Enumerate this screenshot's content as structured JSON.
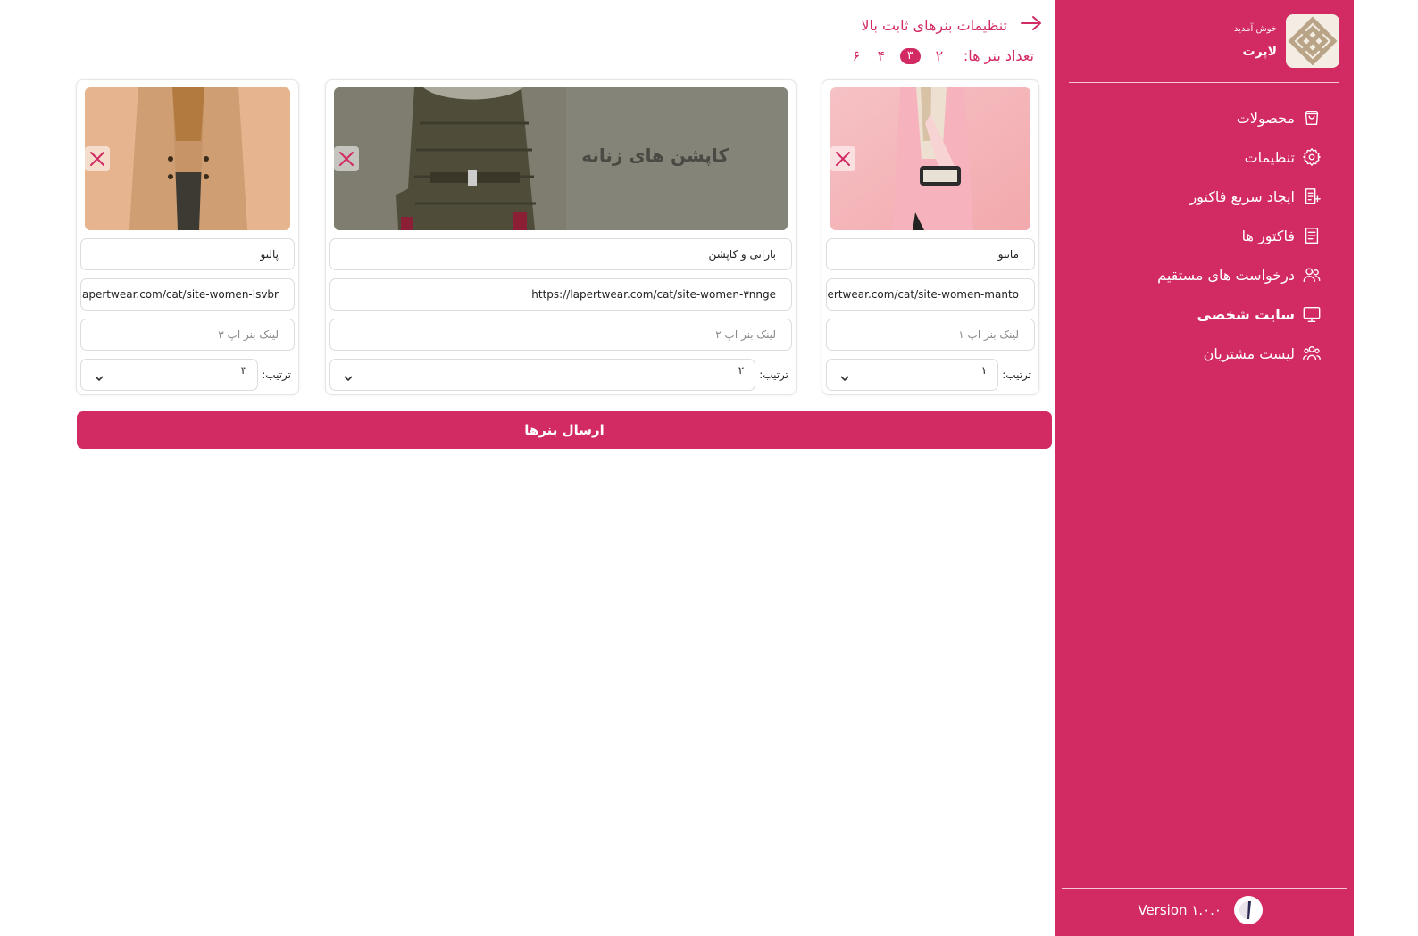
{
  "sidebar": {
    "welcome": "خوش آمدید",
    "brand_name": "لاپرت",
    "items": [
      {
        "label": "محصولات",
        "icon": "shopping-bag-icon"
      },
      {
        "label": "تنظیمات",
        "icon": "gear-icon"
      },
      {
        "label": "ایجاد سریع فاکتور",
        "icon": "invoice-add-icon"
      },
      {
        "label": "فاکتور ها",
        "icon": "invoice-icon"
      },
      {
        "label": "درخواست های مستقیم",
        "icon": "users-icon"
      },
      {
        "label": "سایت شخصی",
        "icon": "monitor-icon"
      },
      {
        "label": "لیست مشتریان",
        "icon": "customers-icon"
      }
    ],
    "active_item": "سایت شخصی",
    "version": "Version ۱.۰.۰"
  },
  "header": {
    "title": "تنظیمات بنرهای ثابت بالا",
    "count_label": "تعداد بنر ها:",
    "count_options": [
      "۲",
      "۳",
      "۴",
      "۶"
    ],
    "count_selected": "۳"
  },
  "banners": [
    {
      "name": "مانتو",
      "link": "https://lapertwear.com/cat/site-women-manto",
      "app_link_placeholder": "لینک بنر اپ ۱",
      "order_label": "ترتیب:",
      "order_value": "۱"
    },
    {
      "name": "بارانی و کاپشن",
      "link": "https://lapertwear.com/cat/site-women-۳nnge",
      "app_link_placeholder": "لینک بنر اپ ۲",
      "order_label": "ترتیب:",
      "order_value": "۲",
      "image_caption": "کاپشن های زنانه"
    },
    {
      "name": "پالتو",
      "link": "https://lapertwear.com/cat/site-women-lsvbr",
      "app_link_placeholder": "لینک بنر اپ ۳",
      "order_label": "ترتیب:",
      "order_value": "۳"
    }
  ],
  "submit_label": "ارسال بنرها",
  "colors": {
    "accent": "#d22a62",
    "sidebar_bg": "#d22a62"
  }
}
